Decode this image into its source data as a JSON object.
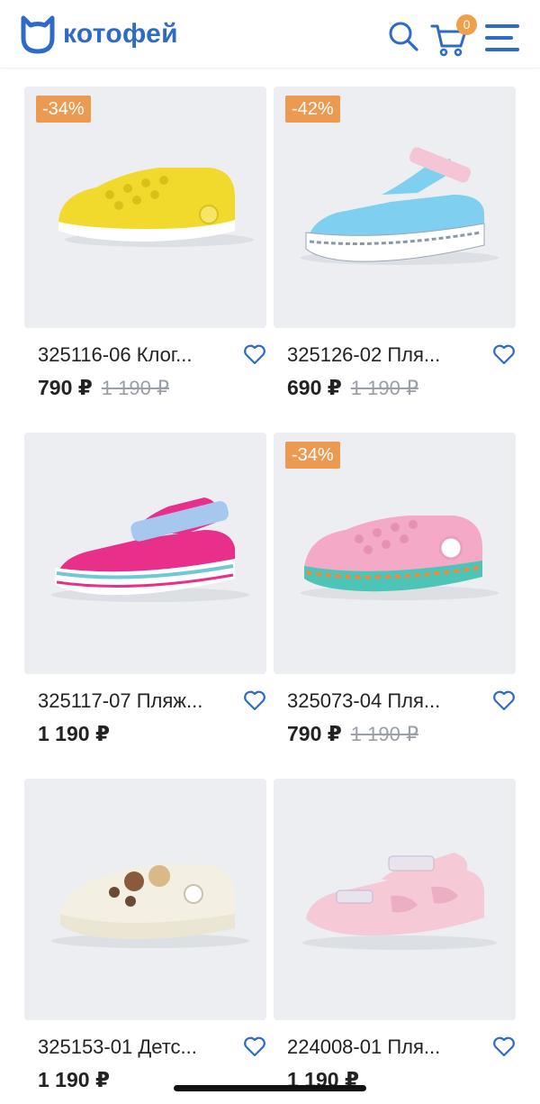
{
  "header": {
    "logo_text": "котофей",
    "cart_count": "0",
    "colors": {
      "brand": "#2e6ac8",
      "badge": "#f0a04a"
    },
    "icons": [
      "logo-cat-icon",
      "search-icon",
      "cart-icon",
      "menu-icon"
    ]
  },
  "products": [
    {
      "name": "325116-06 Клог...",
      "price": "790 ₽",
      "old_price": "1 190 ₽",
      "discount": "-34%",
      "image": "yellow-clog",
      "color": "#f2da2c"
    },
    {
      "name": "325126-02 Пля...",
      "price": "690 ₽",
      "old_price": "1 190 ₽",
      "discount": "-42%",
      "image": "blue-sandal",
      "color": "#7fcff0"
    },
    {
      "name": "325117-07 Пляж...",
      "price": "1 190 ₽",
      "old_price": "",
      "discount": "",
      "image": "pink-sandal",
      "color": "#e8308a"
    },
    {
      "name": "325073-04 Пля...",
      "price": "790 ₽",
      "old_price": "1 190 ₽",
      "discount": "-34%",
      "image": "light-pink-clog",
      "color": "#f4a9c7"
    },
    {
      "name": "325153-01 Детс...",
      "price": "1 190 ₽",
      "old_price": "",
      "discount": "",
      "image": "white-clog",
      "color": "#f3efe3"
    },
    {
      "name": "224008-01 Пля...",
      "price": "1 190 ₽",
      "old_price": "",
      "discount": "",
      "image": "pale-pink-sandal",
      "color": "#f5c9d6"
    }
  ],
  "accent_discount": "#ec9a52"
}
